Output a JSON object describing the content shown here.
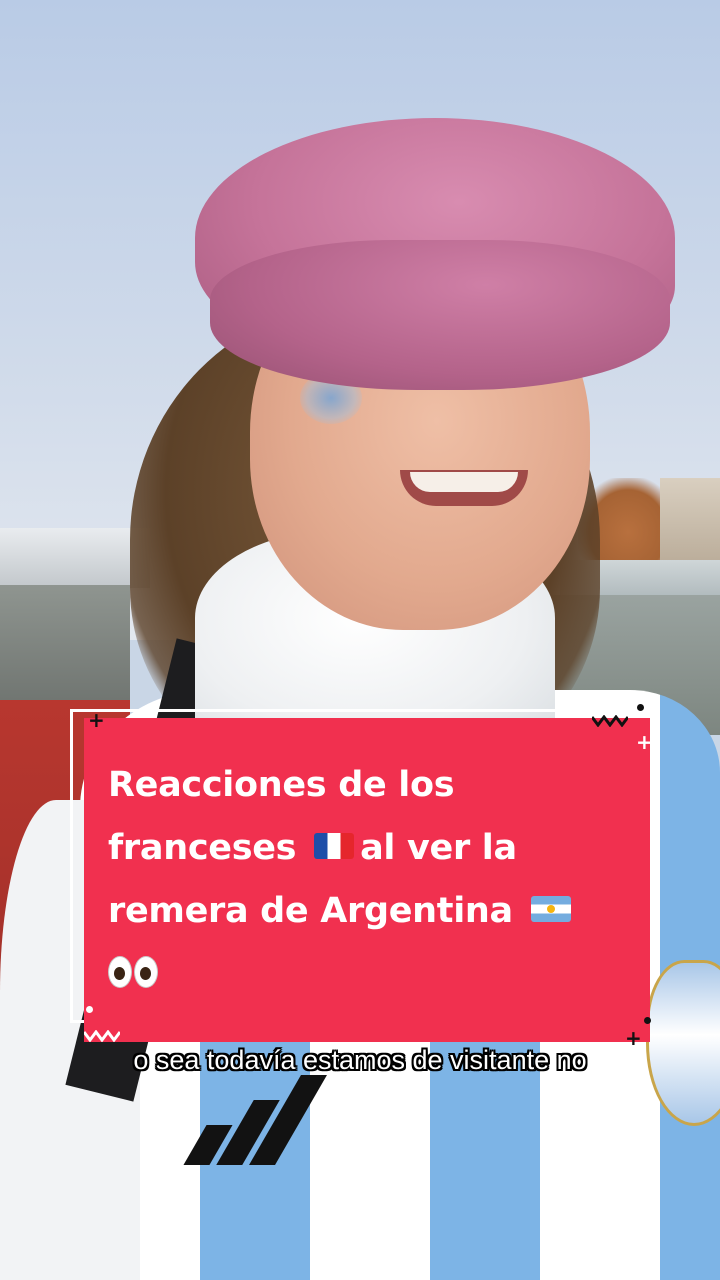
{
  "caption": {
    "line1": "Reacciones de los",
    "line2_pre": "franceses",
    "line2_post": "al ver la",
    "line3": "remera de Argentina",
    "emoji_icons": [
      "france-flag-icon",
      "argentina-flag-icon",
      "eyes-icon"
    ],
    "card_color": "#f1304f"
  },
  "subtitle": "o sea todavía estamos de visitante no"
}
